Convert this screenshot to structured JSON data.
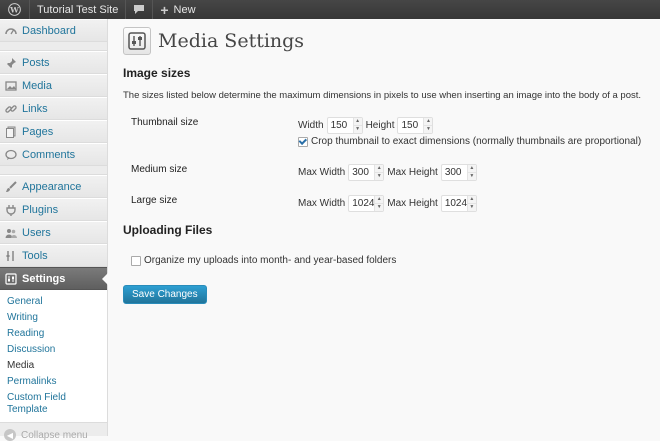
{
  "admin_bar": {
    "wp_logo_icon": "wordpress-logo",
    "site_name": "Tutorial Test Site",
    "comments_icon": "speech-bubble",
    "new_label": "New"
  },
  "sidebar": {
    "groups": [
      [
        {
          "label": "Dashboard",
          "icon": "dashboard"
        }
      ],
      [
        {
          "label": "Posts",
          "icon": "pin"
        },
        {
          "label": "Media",
          "icon": "media"
        },
        {
          "label": "Links",
          "icon": "chain-link"
        },
        {
          "label": "Pages",
          "icon": "pages"
        },
        {
          "label": "Comments",
          "icon": "speech-bubble"
        }
      ],
      [
        {
          "label": "Appearance",
          "icon": "paintbrush"
        },
        {
          "label": "Plugins",
          "icon": "plug"
        },
        {
          "label": "Users",
          "icon": "users"
        },
        {
          "label": "Tools",
          "icon": "wrench"
        },
        {
          "label": "Settings",
          "icon": "settings",
          "current": true
        }
      ]
    ],
    "submenu": [
      "General",
      "Writing",
      "Reading",
      "Discussion",
      "Media",
      "Permalinks",
      "Custom Field Template"
    ],
    "submenu_current": "Media",
    "collapse_label": "Collapse menu"
  },
  "main": {
    "title": "Media Settings",
    "image_sizes_heading": "Image sizes",
    "image_sizes_desc": "The sizes listed below determine the maximum dimensions in pixels to use when inserting an image into the body of a post.",
    "thumbnail": {
      "label": "Thumbnail size",
      "width_label": "Width",
      "width": "150",
      "height_label": "Height",
      "height": "150",
      "crop_label": "Crop thumbnail to exact dimensions (normally thumbnails are proportional)",
      "crop_checked": true
    },
    "medium": {
      "label": "Medium size",
      "width_label": "Max Width",
      "width": "300",
      "height_label": "Max Height",
      "height": "300"
    },
    "large": {
      "label": "Large size",
      "width_label": "Max Width",
      "width": "1024",
      "height_label": "Max Height",
      "height": "1024"
    },
    "uploading_heading": "Uploading Files",
    "organize_label": "Organize my uploads into month- and year-based folders",
    "organize_checked": false,
    "save_label": "Save Changes"
  },
  "colors": {
    "link": "#21759b",
    "admin_bar": "#464646",
    "current_menu": "#6d6d6d",
    "primary_button": "#21759b"
  }
}
